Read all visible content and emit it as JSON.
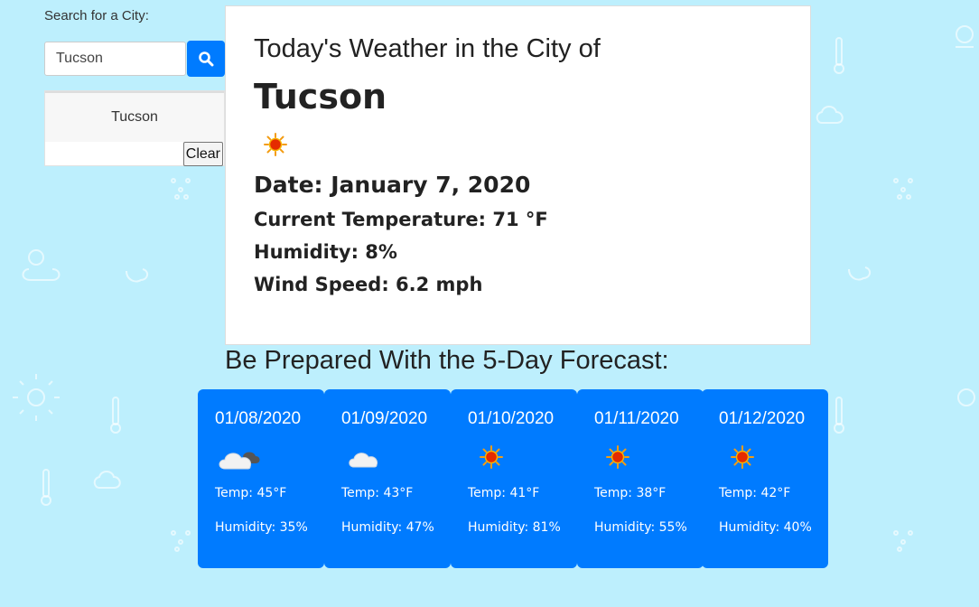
{
  "search": {
    "label": "Search for a City:",
    "value": "Tucson",
    "button_icon": "search-icon",
    "history": [
      "Tucson"
    ],
    "clear_label": "Clear"
  },
  "current": {
    "heading": "Today's Weather in the City of",
    "city": "Tucson",
    "icon": "sun-icon",
    "date": "Date: January 7, 2020",
    "temperature": "Current Temperature: 71 °F",
    "humidity": "Humidity: 8%",
    "wind": "Wind Speed: 6.2 mph"
  },
  "forecast": {
    "title": "Be Prepared With the 5-Day Forecast:",
    "days": [
      {
        "date": "01/08/2020",
        "icon": "partly-cloudy-icon",
        "temp": "Temp: 45°F",
        "humidity": "Humidity: 35%"
      },
      {
        "date": "01/09/2020",
        "icon": "cloud-icon",
        "temp": "Temp: 43°F",
        "humidity": "Humidity: 47%"
      },
      {
        "date": "01/10/2020",
        "icon": "sun-icon",
        "temp": "Temp: 41°F",
        "humidity": "Humidity: 81%"
      },
      {
        "date": "01/11/2020",
        "icon": "sun-icon",
        "temp": "Temp: 38°F",
        "humidity": "Humidity: 55%"
      },
      {
        "date": "01/12/2020",
        "icon": "sun-icon",
        "temp": "Temp: 42°F",
        "humidity": "Humidity: 40%"
      }
    ]
  },
  "colors": {
    "background": "#bdeffd",
    "accent": "#007bff",
    "card": "#ffffff"
  }
}
